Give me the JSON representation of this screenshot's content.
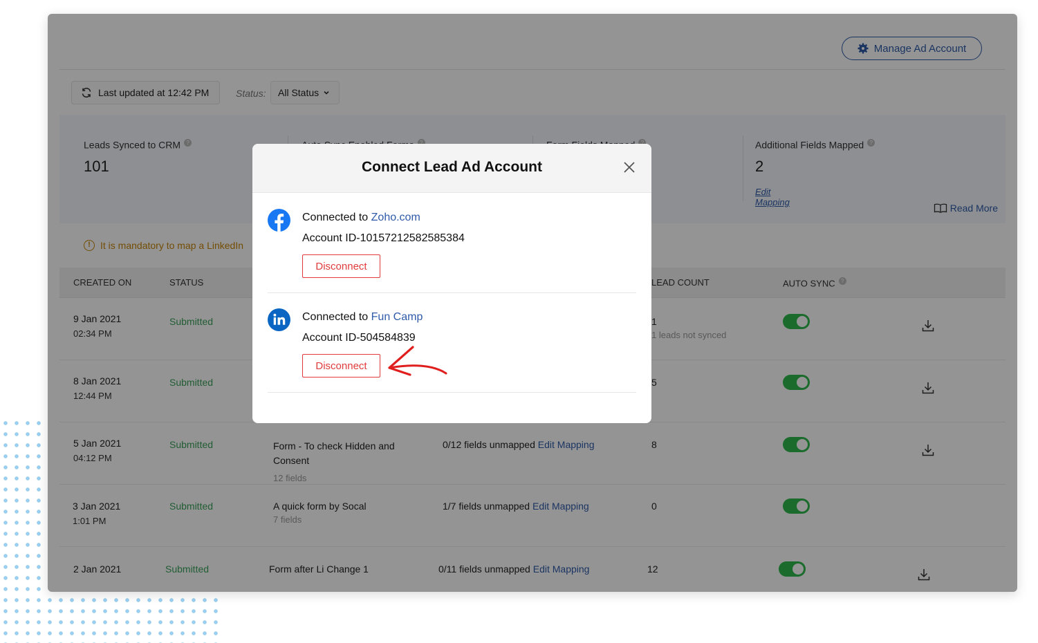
{
  "header": {
    "manage_button": "Manage Ad Account",
    "last_updated": "Last updated at 12:42 PM",
    "status_label": "Status:",
    "status_value": "All Status"
  },
  "stats": [
    {
      "label": "Leads Synced to CRM",
      "value": "101"
    },
    {
      "label": "Auto Sync Enabled Forms",
      "value": ""
    },
    {
      "label": "Form Fields Mapped",
      "value": ""
    },
    {
      "label": "Additional Fields Mapped",
      "value": "2",
      "link": "Edit Mapping"
    }
  ],
  "read_more": "Read More",
  "warning": "It is mandatory to map a LinkedIn",
  "table": {
    "headers": {
      "created_on": "CREATED ON",
      "status": "STATUS",
      "lead_count": "LEAD COUNT",
      "auto_sync": "AUTO SYNC"
    },
    "rows": [
      {
        "date": "9 Jan 2021",
        "time": "02:34 PM",
        "status": "Submitted",
        "form": "",
        "form_fields": "",
        "mapping_text": "",
        "mapping_link": "",
        "lead_count": "1",
        "lead_note": "1 leads not synced"
      },
      {
        "date": "8 Jan 2021",
        "time": "12:44 PM",
        "status": "Submitted",
        "form": "",
        "form_fields": "",
        "mapping_text": "",
        "mapping_link": "",
        "lead_count": "5",
        "lead_note": ""
      },
      {
        "date": "5 Jan 2021",
        "time": "04:12 PM",
        "status": "Submitted",
        "form": "Form - To check Hidden and Consent",
        "form_fields": "12 fields",
        "mapping_text": "0/12 fields unmapped",
        "mapping_link": "Edit Mapping",
        "lead_count": "8",
        "lead_note": ""
      },
      {
        "date": "3 Jan 2021",
        "time": "1:01 PM",
        "status": "Submitted",
        "form": "A quick form by Socal",
        "form_fields": "7 fields",
        "mapping_text": "1/7 fields unmapped",
        "mapping_link": "Edit Mapping",
        "lead_count": "0",
        "lead_note": ""
      },
      {
        "date": "2 Jan 2021",
        "time": "",
        "status": "Submitted",
        "form": "Form after Li Change 1",
        "form_fields": "",
        "mapping_text": "0/11 fields unmapped",
        "mapping_link": "Edit Mapping",
        "lead_count": "12",
        "lead_note": ""
      }
    ]
  },
  "modal": {
    "title": "Connect Lead Ad Account",
    "accounts": [
      {
        "platform_icon": "facebook-icon",
        "connected_prefix": "Connected to",
        "name": "Zoho.com",
        "account_id": "Account ID-10157212582585384",
        "disconnect": "Disconnect"
      },
      {
        "platform_icon": "linkedin-icon",
        "connected_prefix": "Connected to",
        "name": "Fun Camp",
        "account_id": "Account ID-504584839",
        "disconnect": "Disconnect"
      }
    ]
  },
  "colors": {
    "accent": "#2e5aa8",
    "danger": "#e03a3a",
    "success": "#2db84d",
    "warning": "#c8860a",
    "facebook": "#1877f2",
    "linkedin": "#0a66c2"
  }
}
